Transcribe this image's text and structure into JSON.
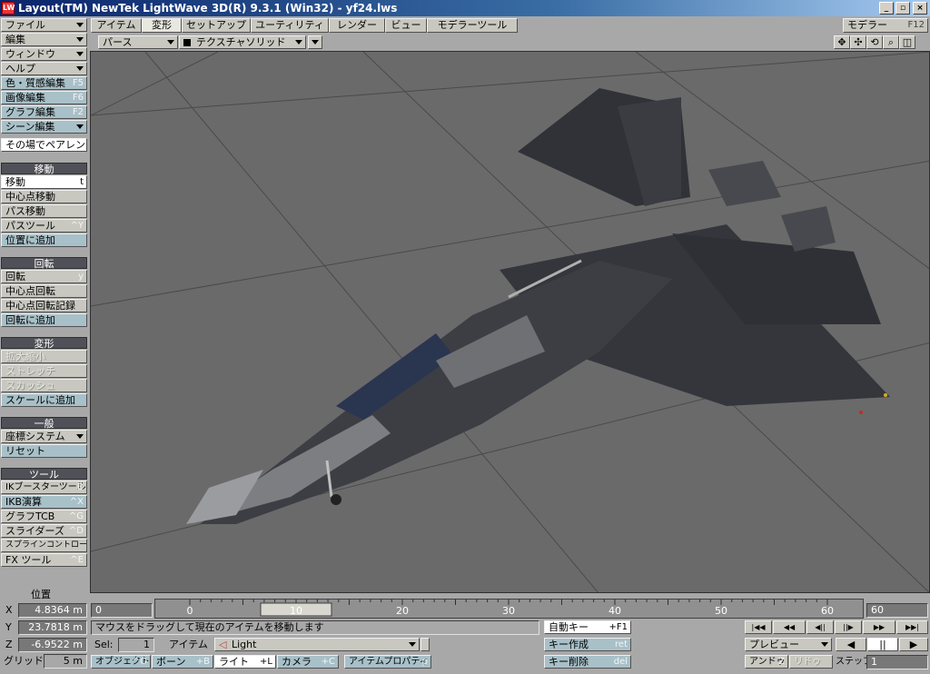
{
  "window": {
    "title": "Layout(TM) NewTek LightWave 3D(R) 9.3.1 (Win32) - yf24.lws",
    "app_icon": "LW"
  },
  "top_menu": [
    {
      "label": "ファイル"
    },
    {
      "label": "編集"
    },
    {
      "label": "ウィンドウ"
    },
    {
      "label": "ヘルプ"
    }
  ],
  "editors": [
    {
      "label": "色・質感編集",
      "shortcut": "F5"
    },
    {
      "label": "画像編集",
      "shortcut": "F6"
    },
    {
      "label": "グラフ編集",
      "shortcut": "F2"
    },
    {
      "label": "シーン編集",
      "shortcut": ""
    }
  ],
  "parent_in_place": "その場でペアレント",
  "tabs": [
    "アイテム",
    "変形",
    "セットアップ",
    "ユーティリティ",
    "レンダー",
    "ビュー",
    "モデラーツール"
  ],
  "modeler_switch": {
    "label": "モデラー",
    "shortcut": "F12"
  },
  "view_mode": "パース",
  "render_mode": "テクスチャソリッド",
  "sections": {
    "move": {
      "title": "移動",
      "items": [
        {
          "label": "移動",
          "shortcut": "t"
        },
        {
          "label": "中心点移動",
          "shortcut": ""
        },
        {
          "label": "パス移動",
          "shortcut": ""
        },
        {
          "label": "パスツール",
          "shortcut": "^Y"
        },
        {
          "label": "位置に追加",
          "shortcut": ""
        }
      ]
    },
    "rotate": {
      "title": "回転",
      "items": [
        {
          "label": "回転",
          "shortcut": "y"
        },
        {
          "label": "中心点回転",
          "shortcut": ""
        },
        {
          "label": "中心点回転記録",
          "shortcut": ""
        },
        {
          "label": "回転に追加",
          "shortcut": ""
        }
      ]
    },
    "transform": {
      "title": "変形",
      "items": [
        {
          "label": "拡大縮小",
          "shortcut": ""
        },
        {
          "label": "ストレッチ",
          "shortcut": ""
        },
        {
          "label": "スカッシュ",
          "shortcut": ""
        },
        {
          "label": "スケールに追加",
          "shortcut": ""
        }
      ]
    },
    "general": {
      "title": "一般",
      "items": [
        {
          "label": "座標システム",
          "shortcut": ""
        },
        {
          "label": "リセット",
          "shortcut": ""
        }
      ]
    },
    "tools": {
      "title": "ツール",
      "items": [
        {
          "label": "IKブースターツール",
          "shortcut": "B"
        },
        {
          "label": "IKB演算",
          "shortcut": "^X"
        },
        {
          "label": "グラフTCB",
          "shortcut": "^G"
        },
        {
          "label": "スライダーズ",
          "shortcut": "^D"
        },
        {
          "label": "スプラインコントロール",
          "shortcut": ""
        },
        {
          "label": "FX ツール",
          "shortcut": "^E"
        }
      ]
    }
  },
  "position": {
    "title": "位置",
    "x_label": "X",
    "x": "4.8364 m",
    "y_label": "Y",
    "y": "23.7818 m",
    "z_label": "Z",
    "z": "-6.9522 m",
    "grid_label": "グリッド:",
    "grid": "5 m"
  },
  "timeline": {
    "start": "0",
    "end": "60",
    "ticks": [
      "0",
      "10",
      "20",
      "30",
      "40",
      "50",
      "60"
    ],
    "current_frame": 10
  },
  "status_message": "マウスをドラッグして現在のアイテムを移動します",
  "sel": {
    "label": "Sel:",
    "value": "1"
  },
  "item": {
    "label": "アイテム",
    "current": "Light"
  },
  "item_types": [
    {
      "label": "オブジェクト",
      "shortcut": "^O"
    },
    {
      "label": "ボーン",
      "shortcut": "+B"
    },
    {
      "label": "ライト",
      "shortcut": "+L"
    },
    {
      "label": "カメラ",
      "shortcut": "+C"
    }
  ],
  "item_properties": {
    "label": "アイテムプロパティ",
    "shortcut": "p"
  },
  "auto_key": {
    "label": "自動キー",
    "shortcut": "+F1"
  },
  "create_key": {
    "label": "キー作成",
    "shortcut": "ret"
  },
  "delete_key": {
    "label": "キー削除",
    "shortcut": "del"
  },
  "preview": "プレビュー",
  "undo": "アンドゥ",
  "undo_shortcut": "Z",
  "redo": "リドゥ",
  "step": {
    "label": "ステップ",
    "value": "1"
  },
  "colors": {
    "viewport": "#6a6a6a",
    "jet": "#3c3e44",
    "nose": "#8a8c90"
  }
}
